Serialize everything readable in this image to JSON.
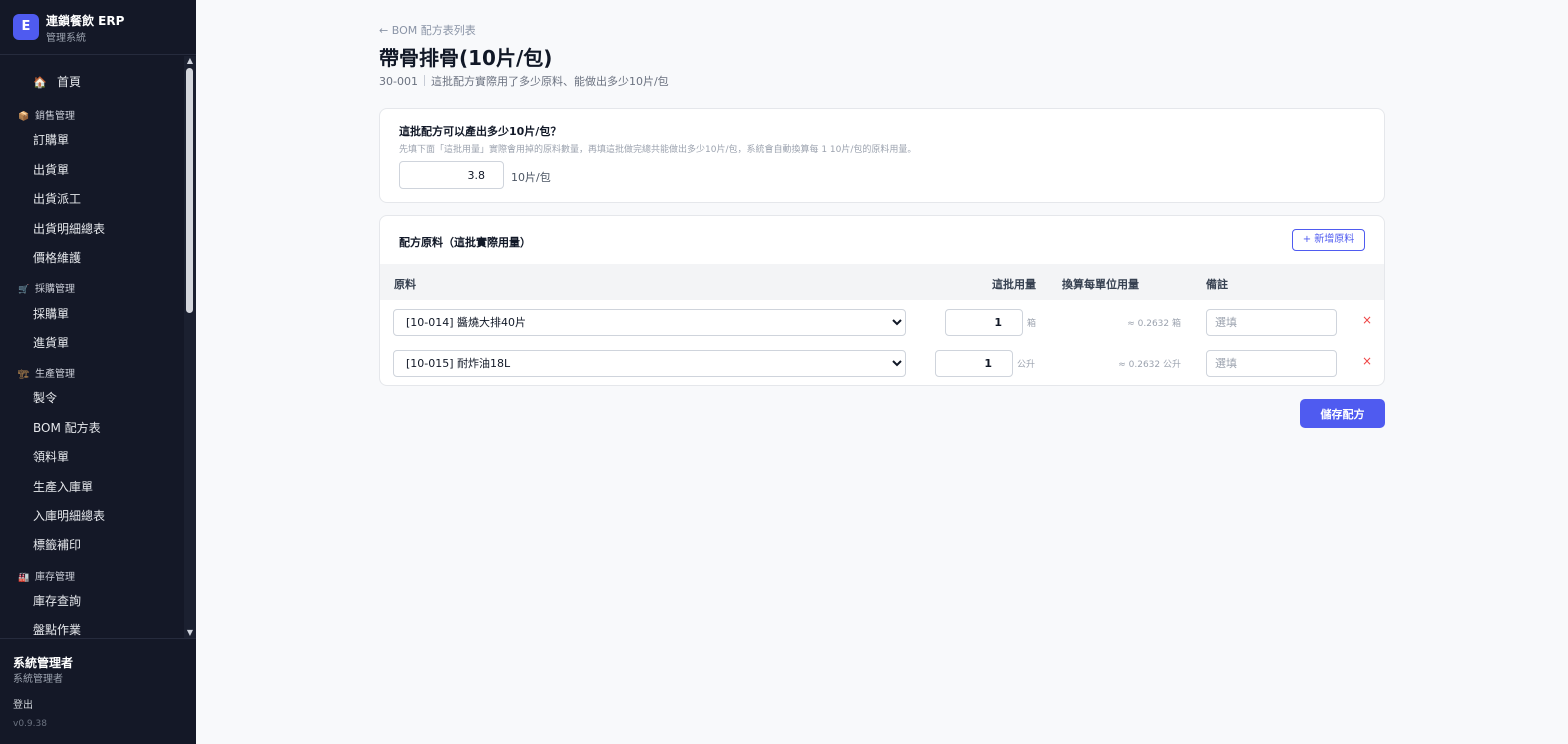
{
  "app": {
    "logo_letter": "E",
    "name": "連鎖餐飲 ERP",
    "subtitle": "管理系統"
  },
  "sidebar": {
    "home": {
      "icon": "🏠",
      "label": "首頁"
    },
    "groups": [
      {
        "icon": "📦",
        "label": "銷售管理",
        "items": [
          "訂購單",
          "出貨單",
          "出貨派工",
          "出貨明細總表",
          "價格維護"
        ]
      },
      {
        "icon": "🛒",
        "label": "採購管理",
        "items": [
          "採購單",
          "進貨單"
        ]
      },
      {
        "icon": "🏗",
        "label": "生產管理",
        "items": [
          "製令",
          "BOM 配方表",
          "領料單",
          "生產入庫單",
          "入庫明細總表",
          "標籤補印"
        ]
      },
      {
        "icon": "🏭",
        "label": "庫存管理",
        "items": [
          "庫存查詢",
          "盤點作業"
        ]
      }
    ],
    "scroll_up": "▲",
    "scroll_down": "▼"
  },
  "user": {
    "name": "系統管理者",
    "role": "系統管理者",
    "logout": "登出",
    "version": "v0.9.38"
  },
  "page": {
    "back_link": "← BOM 配方表列表",
    "title": "帶骨排骨(10片/包)",
    "code": "30-001",
    "description": "這批配方實際用了多少原料、能做出多少10片/包"
  },
  "yield": {
    "question": "這批配方可以產出多少10片/包？",
    "hint": "先填下面「這批用量」實際會用掉的原料數量，再填這批做完總共能做出多少10片/包，系統會自動換算每 1 10片/包的原料用量。",
    "value": "3.8",
    "unit": "10片/包"
  },
  "materials": {
    "title": "配方原料（這批實際用量）",
    "add_label": "+ 新增原料",
    "columns": {
      "material": "原料",
      "qty": "這批用量",
      "per_unit": "換算每單位用量",
      "note": "備註"
    },
    "rows": [
      {
        "material": "[10-014] 醬燒大排40片",
        "qty": "1",
        "unit": "箱",
        "per_unit": "≈ 0.2632 箱",
        "note_placeholder": "選填"
      },
      {
        "material": "[10-015] 耐炸油18L",
        "qty": "1",
        "unit": "公升",
        "per_unit": "≈ 0.2632 公升",
        "note_placeholder": "選填"
      }
    ],
    "delete_icon": "×"
  },
  "actions": {
    "save_label": "儲存配方"
  },
  "colors": {
    "sidebar_bg": "#141827",
    "accent": "#4f5bf0",
    "danger": "#ef4444"
  }
}
